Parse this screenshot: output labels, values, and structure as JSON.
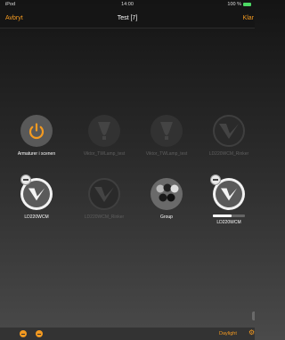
{
  "status": {
    "device": "iPod",
    "time": "14:00",
    "battery": "100 %"
  },
  "nav": {
    "cancel": "Avbryt",
    "title": "Test [7]",
    "done": "Klar"
  },
  "tiles": [
    {
      "label": "Armaturer i scenen"
    },
    {
      "label": "Viktor_TWLamp_test"
    },
    {
      "label": "Viktor_TWLamp_test"
    },
    {
      "label": "LD220WCM_Rinker"
    },
    {
      "label": "LD220WCM"
    },
    {
      "label": "LD220WCM_Rinker"
    },
    {
      "label": "Group"
    },
    {
      "label": "LD220WCM"
    }
  ],
  "last_tile_level": 0.58,
  "footer": {
    "daylight": "Daylight"
  },
  "colors": {
    "accent": "#f39a21"
  }
}
